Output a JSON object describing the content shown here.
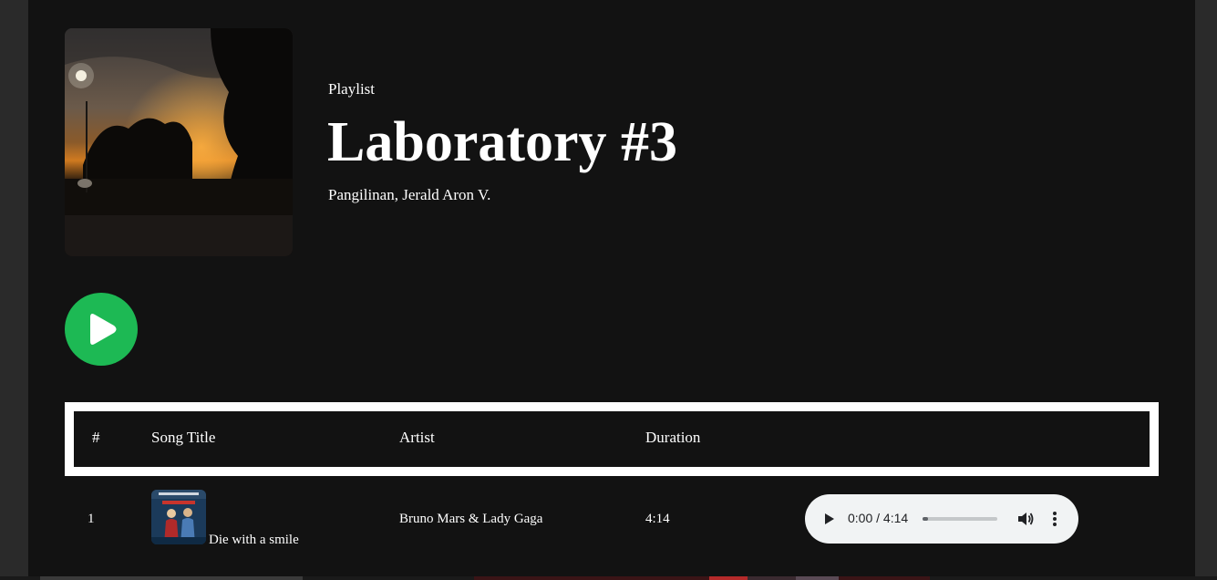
{
  "header": {
    "type_label": "Playlist",
    "title": "Laboratory #3",
    "owner": "Pangilinan, Jerald Aron V."
  },
  "icons": {
    "play_main": "play-icon",
    "audio_play": "play-icon",
    "volume": "volume-icon",
    "more": "more-vertical-icon"
  },
  "colors": {
    "background": "#121212",
    "accent": "#1db954",
    "header_border": "#ffffff",
    "audio_bg": "#f1f3f4"
  },
  "table": {
    "columns": [
      "#",
      "Song Title",
      "Artist",
      "Duration"
    ],
    "rows": [
      {
        "number": "1",
        "title": "Die with a smile",
        "artist": "Bruno Mars & Lady Gaga",
        "duration": "4:14",
        "player": {
          "time": "0:00 / 4:14",
          "progress": 0.0
        }
      }
    ]
  }
}
